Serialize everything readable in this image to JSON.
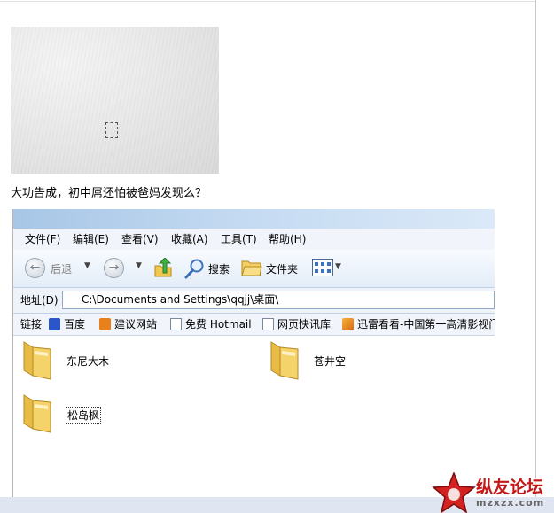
{
  "post": {
    "caption": "大功告成，初中屌还怕被爸妈发现么？"
  },
  "explorer": {
    "menu": [
      "文件(F)",
      "编辑(E)",
      "查看(V)",
      "收藏(A)",
      "工具(T)",
      "帮助(H)"
    ],
    "toolbar": {
      "back_label": "后退",
      "search_label": "搜索",
      "folders_label": "文件夹",
      "icons": [
        "back-icon",
        "forward-icon",
        "up-folder-icon",
        "search-icon",
        "folders-icon",
        "views-icon"
      ]
    },
    "address": {
      "label": "地址(D)",
      "value": "C:\\Documents and Settings\\qqjj\\桌面\\"
    },
    "links": {
      "label": "链接",
      "items": [
        "百度",
        "建议网站",
        "免费 Hotmail",
        "网页快讯库",
        "迅雷看看-中国第一高清影视门"
      ]
    },
    "folders": [
      {
        "name": "东尼大木"
      },
      {
        "name": "苍井空"
      },
      {
        "name": "松岛枫",
        "selected": true
      }
    ]
  },
  "watermark": {
    "text": "纵友论坛",
    "url": "mzxzx.com"
  },
  "colors": {
    "folder": "#f5d36b",
    "menubar": "#f1f5fb",
    "watermark": "#c21818"
  }
}
